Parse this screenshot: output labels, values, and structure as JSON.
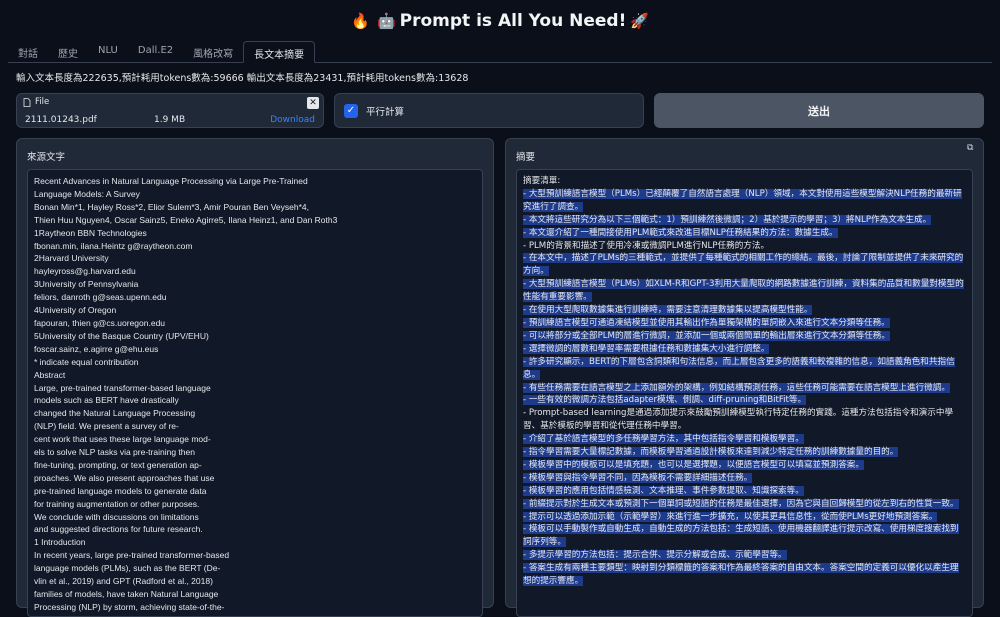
{
  "app": {
    "title": "Prompt is All You Need!",
    "emoji_left": "🔥",
    "emoji_mid": "🤖",
    "emoji_right": "🚀"
  },
  "tabs": [
    {
      "label": "對話"
    },
    {
      "label": "歷史"
    },
    {
      "label": "NLU"
    },
    {
      "label": "Dall.E2"
    },
    {
      "label": "風格改寫"
    },
    {
      "label": "長文本摘要"
    }
  ],
  "stats_text": "輸入文本長度為222635,預計耗用tokens數為:59666 輸出文本長度為23431,預計耗用tokens數為:13628",
  "file": {
    "label": "File",
    "name": "2111.01243.pdf",
    "size": "1.9 MB",
    "download": "Download",
    "close": "✕"
  },
  "parallel": {
    "label": "平行計算",
    "checked": true
  },
  "submit_label": "送出",
  "source": {
    "label": "來源文字",
    "lines": [
      "Recent Advances in Natural Language Processing via Large Pre-Trained",
      "Language Models: A Survey",
      "Bonan Min*1, Hayley Ross*2, Elior Sulem*3, Amir Pouran Ben Veyseh*4,",
      "Thien Huu Nguyen4, Oscar Sainz5, Eneko Agirre5, Ilana Heinz1, and Dan Roth3",
      "1Raytheon BBN Technologies",
      "fbonan.min, ilana.Heintz g@raytheon.com",
      "2Harvard University",
      "hayleyross@g.harvard.edu",
      "3University of Pennsylvania",
      "feliors, danroth g@seas.upenn.edu",
      "4University of Oregon",
      "fapouran, thien g@cs.uoregon.edu",
      "5University of the Basque Country (UPV/EHU)",
      "foscar.sainz, e.agirre g@ehu.eus",
      "* indicate equal contribution",
      "Abstract",
      "Large, pre-trained transformer-based language",
      "models such as BERT have drastically",
      "changed the Natural Language Processing",
      "(NLP) field. We present a survey of re-",
      "cent work that uses these large language mod-",
      "els to solve NLP tasks via pre-training then",
      "fine-tuning, prompting, or text generation ap-",
      "proaches. We also present approaches that use",
      "pre-trained language models to generate data",
      "for training augmentation or other purposes.",
      "We conclude with discussions on limitations",
      "and suggested directions for future research.",
      "1 Introduction",
      "In recent years, large pre-trained transformer-based",
      "language models (PLMs), such as the BERT (De-",
      "vlin et al., 2019) and GPT (Radford et al., 2018)",
      "families of models, have taken Natural Language",
      "Processing (NLP) by storm, achieving state-of-the-"
    ]
  },
  "summary": {
    "label": "摘要",
    "heading": "摘要清單:",
    "lines": [
      {
        "text": "- 大型預訓練語言模型（PLMs）已經顛覆了自然語言處理（NLP）領域，本文對使用這些模型解決NLP任務的最新研究進行了調查。",
        "hl": true
      },
      {
        "text": "- 本文將這些研究分為以下三個範式：1）預訓練然後微調；2）基於提示的學習；3）將NLP作為文本生成。",
        "hl": true
      },
      {
        "text": "- 本文還介紹了一種間接使用PLM範式來改進目標NLP任務結果的方法：數據生成。",
        "hl": true
      },
      {
        "text": "- PLM的背景和描述了使用冷凍或微調PLM進行NLP任務的方法。",
        "hl": false
      },
      {
        "text": "- 在本文中，描述了PLMs的三種範式，並提供了每種範式的相關工作的總結。最後，討論了限制並提供了未來研究的方向。",
        "hl": true
      },
      {
        "text": "- 大型預訓練語言模型（PLMs）如XLM-R和GPT-3利用大量爬取的網路數據進行訓練，資料集的品質和數量對模型的性能有重要影響。",
        "hl": true
      },
      {
        "text": "- 在使用大型爬取數據集進行訓練時，需要注意清理數據集以提高模型性能。",
        "hl": true
      },
      {
        "text": "- 預訓練語言模型可通過凍結模型並使用其輸出作為單獨架構的單詞嵌入來進行文本分類等任務。",
        "hl": true
      },
      {
        "text": "- 可以將部分或全部PLM的層進行微調，並添加一個或兩個簡單的輸出層來進行文本分類等任務。",
        "hl": true
      },
      {
        "text": "- 選擇微調的層數和學習率需要根據任務和數據集大小進行調整。",
        "hl": true
      },
      {
        "text": "- 許多研究顯示，BERT的下層包含詞類和句法信息，而上層包含更多的語義和較複雜的信息，如語義角色和共指信息。",
        "hl": true
      },
      {
        "text": "- 有些任務需要在語言模型之上添加額外的架構，例如結構預測任務，這些任務可能需要在語言模型上進行微調。",
        "hl": true
      },
      {
        "text": "- 一些有效的微調方法包括adapter模塊、側調、diff-pruning和BitFit等。",
        "hl": true
      },
      {
        "text": "- Prompt-based learning是通過添加提示來鼓勵預訓練模型執行特定任務的實踐。這種方法包括指令和演示中學習、基於模板的學習和從代理任務中學習。",
        "hl": false
      },
      {
        "text": "- 介紹了基於語言模型的多任務學習方法，其中包括指令學習和模板學習。",
        "hl": true
      },
      {
        "text": "- 指令學習需要大量標記數據，而模板學習通過設計模板來達到減少特定任務的訓練數據量的目的。",
        "hl": true
      },
      {
        "text": "- 模板學習中的模板可以是填充題，也可以是選擇題，以便語言模型可以填寫並預測答案。",
        "hl": true
      },
      {
        "text": "- 模板學習與指令學習不同，因為模板不需要詳細描述任務。",
        "hl": true
      },
      {
        "text": "- 模板學習的應用包括情感檢測、文本推理、事件參數提取、知識探索等。",
        "hl": true
      },
      {
        "text": "- 前綴提示對於生成文本或預測下一個單詞或短語的任務是最佳選擇，因為它與自回歸模型的從左到右的性質一致。",
        "hl": true
      },
      {
        "text": "- 提示可以透過添加示範（示範學習）來進行進一步擴充，以使其更具信息性，從而使PLMs更好地預測答案。",
        "hl": true
      },
      {
        "text": "- 模板可以手動製作或自動生成，自動生成的方法包括：生成短語、使用機器翻譯進行提示改寫、使用梯度搜索找到詞序列等。",
        "hl": true
      },
      {
        "text": "- 多提示學習的方法包括：提示合併、提示分解或合成、示範學習等。",
        "hl": true
      },
      {
        "text": "- 答案生成有兩種主要類型：映射到分類標籤的答案和作為最終答案的自由文本。答案空間的定義可以優化以產生理想的提示響應。",
        "hl": true
      }
    ]
  }
}
